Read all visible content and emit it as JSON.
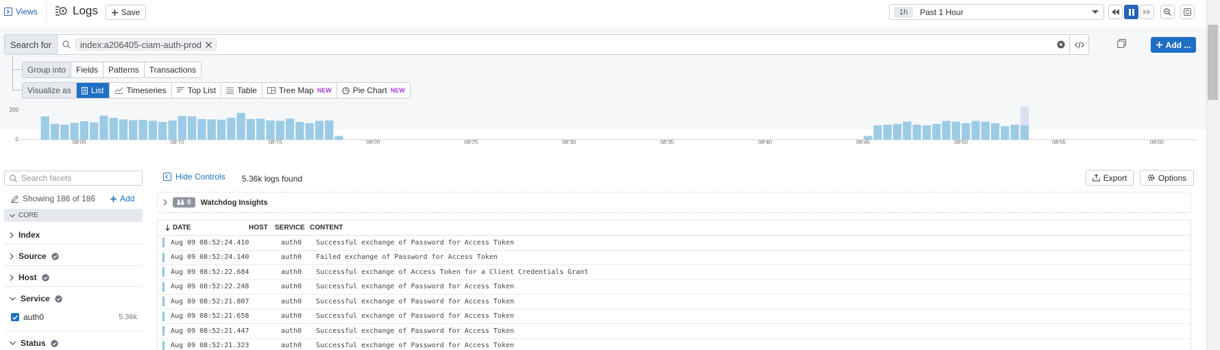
{
  "header": {
    "views_label": "Views",
    "title": "Logs",
    "save_label": "Save",
    "time_chip": "1h",
    "time_range": "Past 1 Hour"
  },
  "search": {
    "prefix": "Search for",
    "query": "index:a206405-ciam-auth-prod",
    "add_label": "Add ..."
  },
  "group_into": {
    "label": "Group into",
    "options": [
      "Fields",
      "Patterns",
      "Transactions"
    ]
  },
  "visualize": {
    "label": "Visualize as",
    "options": [
      {
        "label": "List",
        "active": true,
        "new": ""
      },
      {
        "label": "Timeseries",
        "active": false,
        "new": ""
      },
      {
        "label": "Top List",
        "active": false,
        "new": ""
      },
      {
        "label": "Table",
        "active": false,
        "new": ""
      },
      {
        "label": "Tree Map",
        "active": false,
        "new": "NEW"
      },
      {
        "label": "Pie Chart",
        "active": false,
        "new": "NEW"
      }
    ]
  },
  "chart_data": {
    "type": "bar",
    "ylim": [
      0,
      200
    ],
    "y_ticks": [
      "200",
      "0"
    ],
    "x_ticks": [
      "08:05",
      "08:10",
      "08:15",
      "08:20",
      "08:25",
      "08:30",
      "08:35",
      "08:40",
      "08:45",
      "08:50",
      "08:55",
      "09:00"
    ],
    "series": [
      {
        "start": "08:03",
        "interval_sec": 30,
        "values": [
          155,
          105,
          100,
          112,
          122,
          115,
          160,
          145,
          135,
          130,
          132,
          126,
          118,
          128,
          158,
          155,
          138,
          135,
          133,
          146,
          178,
          138,
          140,
          128,
          125,
          140,
          118,
          110,
          125,
          128,
          25
        ]
      },
      {
        "start": "08:45",
        "interval_sec": 30,
        "values": [
          25,
          95,
          100,
          105,
          120,
          100,
          95,
          105,
          125,
          120,
          110,
          125,
          120,
          110,
          90,
          100,
          95
        ]
      }
    ],
    "highlight_last": true,
    "grid": true
  },
  "facets": {
    "search_placeholder": "Search facets",
    "showing": "Showing 186 of 186",
    "add_label": "Add",
    "core_label": "CORE",
    "items": [
      "Index",
      "Source",
      "Host",
      "Service",
      "Status"
    ],
    "service_value": "auth0",
    "service_count": "5.36k"
  },
  "results": {
    "hide_controls": "Hide Controls",
    "count_text": "5.36k logs found",
    "export_label": "Export",
    "options_label": "Options",
    "watchdog_count": "0",
    "watchdog_label": "Watchdog Insights",
    "columns": [
      "DATE",
      "HOST",
      "SERVICE",
      "CONTENT"
    ],
    "rows": [
      {
        "date": "Aug 09 08:52:24.410",
        "service": "auth0",
        "content": "Successful exchange of Password for Access Token"
      },
      {
        "date": "Aug 09 08:52:24.140",
        "service": "auth0",
        "content": "Failed exchange of Password for Access Token"
      },
      {
        "date": "Aug 09 08:52:22.684",
        "service": "auth0",
        "content": "Successful exchange of Access Token for a Client Credentials Grant"
      },
      {
        "date": "Aug 09 08:52:22.248",
        "service": "auth0",
        "content": "Successful exchange of Password for Access Token"
      },
      {
        "date": "Aug 09 08:52:21.807",
        "service": "auth0",
        "content": "Successful exchange of Password for Access Token"
      },
      {
        "date": "Aug 09 08:52:21.658",
        "service": "auth0",
        "content": "Successful exchange of Password for Access Token"
      },
      {
        "date": "Aug 09 08:52:21.447",
        "service": "auth0",
        "content": "Successful exchange of Password for Access Token"
      },
      {
        "date": "Aug 09 08:52:21.323",
        "service": "auth0",
        "content": "Successful exchange of Password for Access Token"
      }
    ]
  },
  "colors": {
    "accent": "#1f6fc5",
    "bar": "#9ccbe6",
    "highlight": "#dcdff0"
  }
}
